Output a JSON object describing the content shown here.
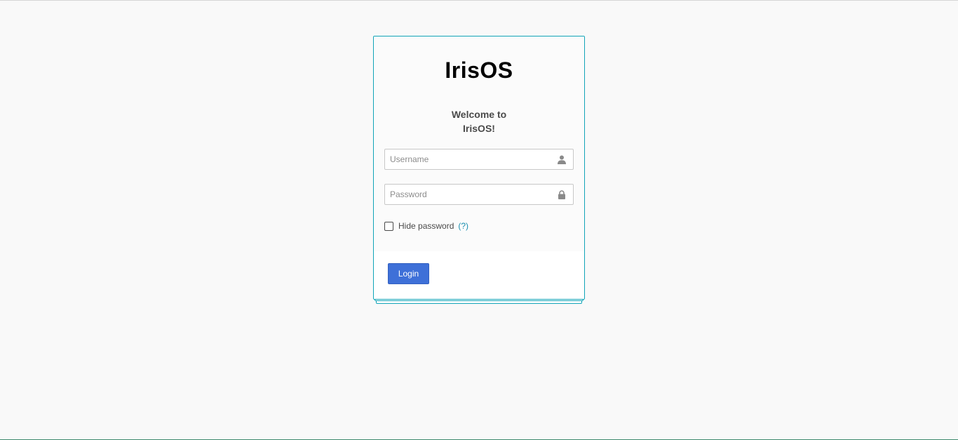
{
  "logo": {
    "text": "IrisOS"
  },
  "welcome": {
    "line1": "Welcome to",
    "line2": "IrisOS!"
  },
  "form": {
    "username": {
      "value": "",
      "placeholder": "Username",
      "icon": "user-icon"
    },
    "password": {
      "value": "",
      "placeholder": "Password",
      "icon": "lock-icon"
    },
    "hide_password": {
      "label": "Hide password",
      "checked": false,
      "help": "(?)"
    },
    "login_label": "Login"
  },
  "colors": {
    "accent": "#11a5b8",
    "button": "#3e70d8",
    "help_link": "#1a8fb0",
    "background": "#f9f9f9"
  }
}
